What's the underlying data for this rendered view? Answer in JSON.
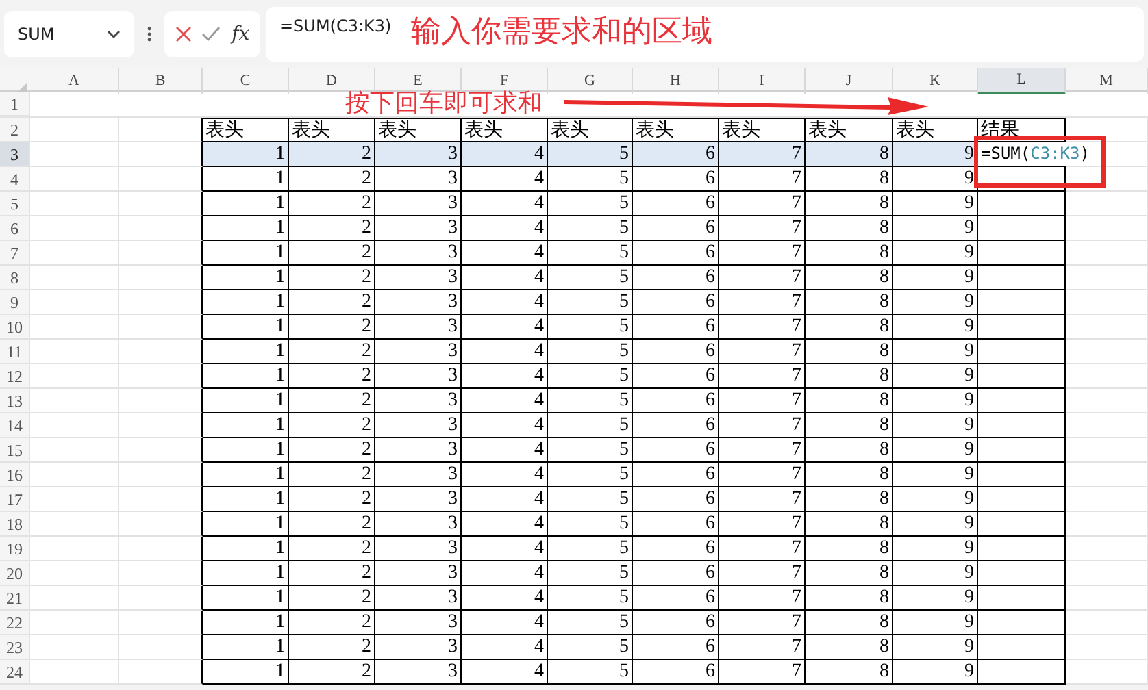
{
  "name_box": "SUM",
  "formula_bar": {
    "function_label": "fx",
    "value": "=SUM(C3:K3)"
  },
  "columns": [
    {
      "label": "A",
      "selected": false
    },
    {
      "label": "B",
      "selected": false
    },
    {
      "label": "C",
      "selected": false
    },
    {
      "label": "D",
      "selected": false
    },
    {
      "label": "E",
      "selected": false
    },
    {
      "label": "F",
      "selected": false
    },
    {
      "label": "G",
      "selected": false
    },
    {
      "label": "H",
      "selected": false
    },
    {
      "label": "I",
      "selected": false
    },
    {
      "label": "J",
      "selected": false
    },
    {
      "label": "K",
      "selected": false
    },
    {
      "label": "L",
      "selected": true
    },
    {
      "label": "M",
      "selected": false
    }
  ],
  "rows": [
    {
      "number": "1",
      "selected": false,
      "cells": []
    },
    {
      "number": "2",
      "selected": false,
      "cells": [
        "表头",
        "表头",
        "表头",
        "表头",
        "表头",
        "表头",
        "表头",
        "表头",
        "表头"
      ],
      "result": {
        "kind": "text",
        "text": "结果"
      }
    },
    {
      "number": "3",
      "selected": true,
      "cells": [
        "1",
        "2",
        "3",
        "4",
        "5",
        "6",
        "7",
        "8",
        "9"
      ],
      "result": {
        "kind": "formula",
        "func": "=SUM(",
        "ref": "C3:K3",
        "close": ")"
      }
    },
    {
      "number": "4",
      "selected": false,
      "cells": [
        "1",
        "2",
        "3",
        "4",
        "5",
        "6",
        "7",
        "8",
        "9"
      ]
    },
    {
      "number": "5",
      "selected": false,
      "cells": [
        "1",
        "2",
        "3",
        "4",
        "5",
        "6",
        "7",
        "8",
        "9"
      ]
    },
    {
      "number": "6",
      "selected": false,
      "cells": [
        "1",
        "2",
        "3",
        "4",
        "5",
        "6",
        "7",
        "8",
        "9"
      ]
    },
    {
      "number": "7",
      "selected": false,
      "cells": [
        "1",
        "2",
        "3",
        "4",
        "5",
        "6",
        "7",
        "8",
        "9"
      ]
    },
    {
      "number": "8",
      "selected": false,
      "cells": [
        "1",
        "2",
        "3",
        "4",
        "5",
        "6",
        "7",
        "8",
        "9"
      ]
    },
    {
      "number": "9",
      "selected": false,
      "cells": [
        "1",
        "2",
        "3",
        "4",
        "5",
        "6",
        "7",
        "8",
        "9"
      ]
    },
    {
      "number": "10",
      "selected": false,
      "cells": [
        "1",
        "2",
        "3",
        "4",
        "5",
        "6",
        "7",
        "8",
        "9"
      ]
    },
    {
      "number": "11",
      "selected": false,
      "cells": [
        "1",
        "2",
        "3",
        "4",
        "5",
        "6",
        "7",
        "8",
        "9"
      ]
    },
    {
      "number": "12",
      "selected": false,
      "cells": [
        "1",
        "2",
        "3",
        "4",
        "5",
        "6",
        "7",
        "8",
        "9"
      ]
    },
    {
      "number": "13",
      "selected": false,
      "cells": [
        "1",
        "2",
        "3",
        "4",
        "5",
        "6",
        "7",
        "8",
        "9"
      ]
    },
    {
      "number": "14",
      "selected": false,
      "cells": [
        "1",
        "2",
        "3",
        "4",
        "5",
        "6",
        "7",
        "8",
        "9"
      ]
    },
    {
      "number": "15",
      "selected": false,
      "cells": [
        "1",
        "2",
        "3",
        "4",
        "5",
        "6",
        "7",
        "8",
        "9"
      ]
    },
    {
      "number": "16",
      "selected": false,
      "cells": [
        "1",
        "2",
        "3",
        "4",
        "5",
        "6",
        "7",
        "8",
        "9"
      ]
    },
    {
      "number": "17",
      "selected": false,
      "cells": [
        "1",
        "2",
        "3",
        "4",
        "5",
        "6",
        "7",
        "8",
        "9"
      ]
    },
    {
      "number": "18",
      "selected": false,
      "cells": [
        "1",
        "2",
        "3",
        "4",
        "5",
        "6",
        "7",
        "8",
        "9"
      ]
    },
    {
      "number": "19",
      "selected": false,
      "cells": [
        "1",
        "2",
        "3",
        "4",
        "5",
        "6",
        "7",
        "8",
        "9"
      ]
    },
    {
      "number": "20",
      "selected": false,
      "cells": [
        "1",
        "2",
        "3",
        "4",
        "5",
        "6",
        "7",
        "8",
        "9"
      ]
    },
    {
      "number": "21",
      "selected": false,
      "cells": [
        "1",
        "2",
        "3",
        "4",
        "5",
        "6",
        "7",
        "8",
        "9"
      ]
    },
    {
      "number": "22",
      "selected": false,
      "cells": [
        "1",
        "2",
        "3",
        "4",
        "5",
        "6",
        "7",
        "8",
        "9"
      ]
    },
    {
      "number": "23",
      "selected": false,
      "cells": [
        "1",
        "2",
        "3",
        "4",
        "5",
        "6",
        "7",
        "8",
        "9"
      ]
    },
    {
      "number": "24",
      "selected": false,
      "cells": [
        "1",
        "2",
        "3",
        "4",
        "5",
        "6",
        "7",
        "8",
        "9"
      ]
    }
  ],
  "annotation": {
    "lines": [
      "输入你需要求和的区域",
      "按下回车即可求和"
    ]
  }
}
